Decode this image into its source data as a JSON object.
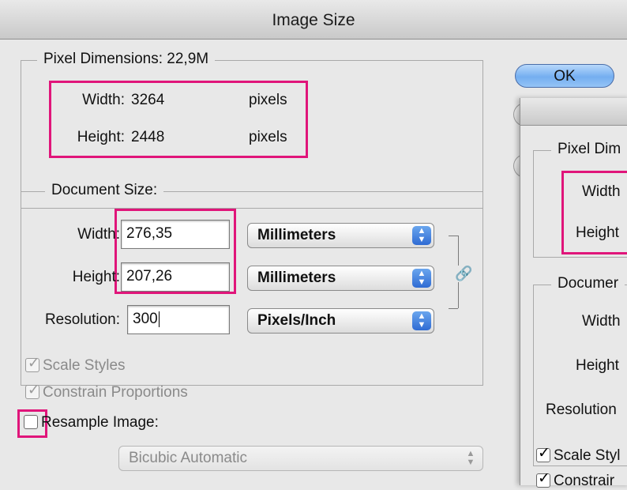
{
  "window": {
    "title": "Image Size"
  },
  "pixel_dimensions": {
    "legend": "Pixel Dimensions:  22,9M",
    "width_label": "Width:",
    "width_value": "3264",
    "height_label": "Height:",
    "height_value": "2448",
    "unit": "pixels"
  },
  "document_size": {
    "legend": "Document Size:",
    "width_label": "Width:",
    "width_value": "276,35",
    "width_unit": "Millimeters",
    "height_label": "Height:",
    "height_value": "207,26",
    "height_unit": "Millimeters",
    "resolution_label": "Resolution:",
    "resolution_value": "300",
    "resolution_unit": "Pixels/Inch"
  },
  "options": {
    "scale_styles": "Scale Styles",
    "constrain_proportions": "Constrain Proportions",
    "resample_image": "Resample Image:",
    "resample_method": "Bicubic Automatic"
  },
  "buttons": {
    "ok": "OK"
  },
  "second_window": {
    "pixel_dims_legend": "Pixel Dim",
    "width_label": "Width",
    "height_label": "Height",
    "document_legend": "Documer",
    "doc_width_label": "Width",
    "doc_height_label": "Height",
    "resolution_label": "Resolution",
    "scale_styles": "Scale Styl",
    "constrain": "Constrair"
  },
  "colors": {
    "highlight": "#e0157a",
    "stepper": "#2f6bd3"
  },
  "icons": [
    "checkbox-checked-icon",
    "checkbox-empty-icon",
    "stepper-arrows-icon",
    "chain-link-icon"
  ]
}
